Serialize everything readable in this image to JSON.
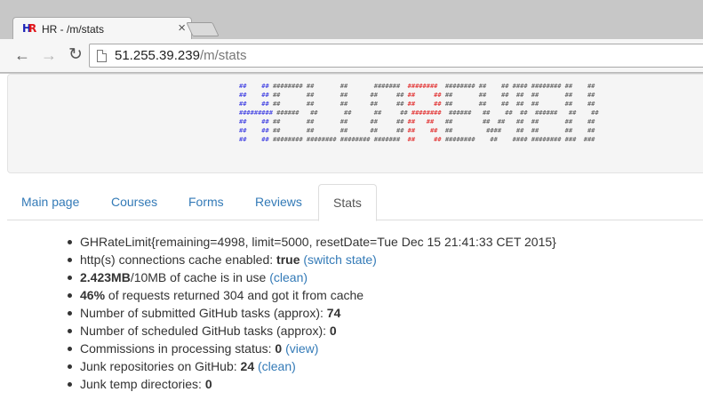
{
  "browser": {
    "tab_title": "HR - /m/stats",
    "favicon_text": "HR",
    "url_host": "51.255.39.239",
    "url_path": "/m/stats"
  },
  "banner": {
    "ascii_rows": [
      [
        [
          "b",
          "##    ## "
        ],
        [
          "g",
          "######## ##       ##       #######  "
        ],
        [
          "rd",
          "########  "
        ],
        [
          "g",
          "######## ##    ## #### ######## ##    ##"
        ]
      ],
      [
        [
          "b",
          "##    ## "
        ],
        [
          "g",
          "##       ##       ##      ##     ## "
        ],
        [
          "rd",
          "##     ## "
        ],
        [
          "g",
          "##       ##    ##  ##  ##       ##    ##"
        ]
      ],
      [
        [
          "b",
          "##    ## "
        ],
        [
          "g",
          "##       ##       ##      ##     ## "
        ],
        [
          "rd",
          "##     ## "
        ],
        [
          "g",
          "##       ##    ##  ##  ##       ##    ##"
        ]
      ],
      [
        [
          "b",
          "######### "
        ],
        [
          "g",
          "######   ##       ##      ##     ## "
        ],
        [
          "rd",
          "########  "
        ],
        [
          "g",
          "######   ##    ##  ##  ######   ##    ##"
        ]
      ],
      [
        [
          "b",
          "##    ## "
        ],
        [
          "g",
          "##       ##       ##      ##     ## "
        ],
        [
          "rd",
          "##   ##   "
        ],
        [
          "g",
          "##        ##  ##   ##  ##       ##    ##"
        ]
      ],
      [
        [
          "b",
          "##    ## "
        ],
        [
          "g",
          "##       ##       ##      ##     ## "
        ],
        [
          "rd",
          "##    ##  "
        ],
        [
          "g",
          "##         ####    ##  ##       ##    ##"
        ]
      ],
      [
        [
          "b",
          "##    ## "
        ],
        [
          "g",
          "######## ######## ######## #######  "
        ],
        [
          "rd",
          "##     ## "
        ],
        [
          "g",
          "########    ##    #### ######## ###  ###"
        ]
      ]
    ]
  },
  "tabs": [
    {
      "label": "Main page",
      "active": false
    },
    {
      "label": "Courses",
      "active": false
    },
    {
      "label": "Forms",
      "active": false
    },
    {
      "label": "Reviews",
      "active": false
    },
    {
      "label": "Stats",
      "active": true
    }
  ],
  "stats": {
    "rate_limit": "GHRateLimit{remaining=4998, limit=5000, resetDate=Tue Dec 15 21:41:33 CET 2015}",
    "cache_label": "http(s) connections cache enabled: ",
    "cache_value": "true",
    "cache_link": "(switch state)",
    "cache_used_value": "2.423MB",
    "cache_used_rest": "/10MB of cache is in use ",
    "cache_used_link": "(clean)",
    "requests_value": "46%",
    "requests_rest": " of requests returned 304 and got it from cache",
    "submitted_label": "Number of submitted GitHub tasks (approx): ",
    "submitted_value": "74",
    "scheduled_label": "Number of scheduled GitHub tasks (approx): ",
    "scheduled_value": "0",
    "commissions_label": "Commissions in processing status: ",
    "commissions_value": "0",
    "commissions_link": "(view)",
    "junk_repos_label": "Junk repositories on GitHub: ",
    "junk_repos_value": "24",
    "junk_repos_link": "(clean)",
    "junk_temp_label": "Junk temp directories: ",
    "junk_temp_value": "0"
  },
  "colors": {
    "link": "#337ab7",
    "ascii_blue": "#3030e0",
    "ascii_red": "#e02020"
  }
}
